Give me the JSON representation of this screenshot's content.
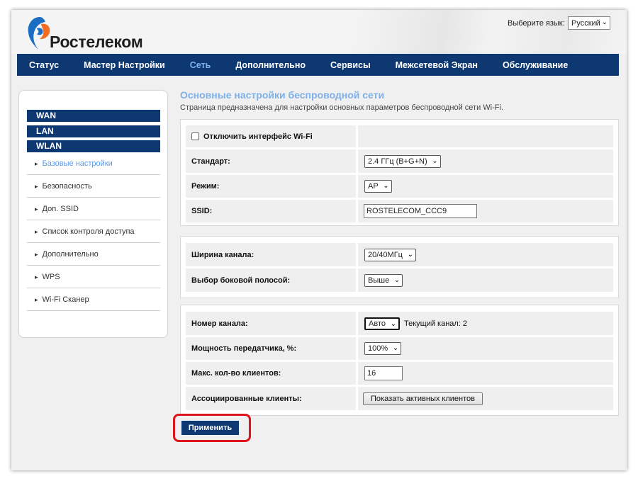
{
  "brand": {
    "name": "Ростелеком",
    "colors": {
      "blue": "#1b6dc1",
      "orange": "#f26c21",
      "navy": "#0e3872"
    }
  },
  "language": {
    "label": "Выберите язык:",
    "selected": "Русский"
  },
  "topnav": [
    {
      "label": "Статус",
      "active": false
    },
    {
      "label": "Мастер Настройки",
      "active": false
    },
    {
      "label": "Сеть",
      "active": true
    },
    {
      "label": "Дополнительно",
      "active": false
    },
    {
      "label": "Сервисы",
      "active": false
    },
    {
      "label": "Межсетевой Экран",
      "active": false
    },
    {
      "label": "Обслуживание",
      "active": false
    }
  ],
  "sidebar": {
    "groups": [
      "WAN",
      "LAN",
      "WLAN"
    ],
    "items": [
      {
        "label": "Базовые настройки",
        "active": true
      },
      {
        "label": "Безопасность"
      },
      {
        "label": "Доп. SSID"
      },
      {
        "label": "Список контроля доступа"
      },
      {
        "label": "Дополнительно"
      },
      {
        "label": "WPS"
      },
      {
        "label": "Wi-Fi Сканер"
      }
    ]
  },
  "page": {
    "title": "Основные настройки беспроводной сети",
    "description": "Страница предназначена для настройки основных параметров беспроводной сети Wi-Fi."
  },
  "form": {
    "disable_wifi": {
      "label": "Отключить интерфейс Wi-Fi",
      "checked": false
    },
    "standard": {
      "label": "Стандарт:",
      "value": "2.4 ГГц (B+G+N)"
    },
    "mode": {
      "label": "Режим:",
      "value": "AP"
    },
    "ssid": {
      "label": "SSID:",
      "value": "ROSTELECOM_CCC9"
    },
    "channel_width": {
      "label": "Ширина канала:",
      "value": "20/40МГц"
    },
    "sideband": {
      "label": "Выбор боковой полосой:",
      "value": "Выше"
    },
    "channel": {
      "label": "Номер канала:",
      "value": "Авто",
      "current": "Текущий канал: 2"
    },
    "tx_power": {
      "label": "Мощность передатчика, %:",
      "value": "100%"
    },
    "max_clients": {
      "label": "Макс. кол-во клиентов:",
      "value": "16"
    },
    "assoc_clients": {
      "label": "Ассоциированные клиенты:",
      "button": "Показать активных клиентов"
    }
  },
  "apply_button": "Применить",
  "icons": {
    "dropdown": "chevron-down-icon",
    "bullet": "triangle-bullet-icon"
  }
}
